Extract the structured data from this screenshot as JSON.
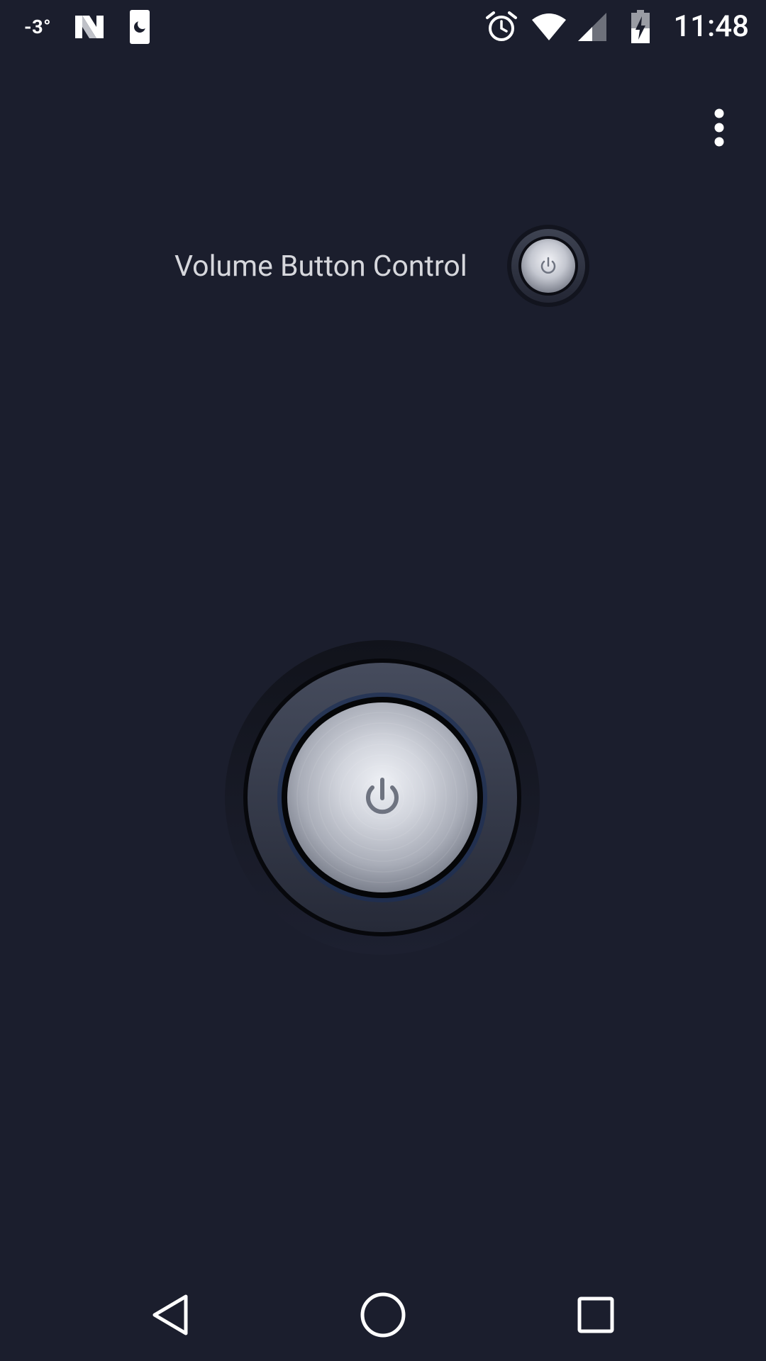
{
  "status_bar": {
    "temperature": "-3°",
    "time": "11:48",
    "left_icons": [
      "nova-launcher-icon",
      "night-mode-icon"
    ],
    "right_icons": [
      "alarm-icon",
      "wifi-icon",
      "cell-signal-icon",
      "battery-charging-icon"
    ]
  },
  "toolbar": {
    "menu_icon": "more-vert-icon"
  },
  "settings": {
    "volume_label": "Volume Button Control"
  },
  "main": {
    "power_icon": "power-icon"
  },
  "nav_bar": {
    "buttons": [
      "back-icon",
      "home-icon",
      "recents-icon"
    ]
  },
  "colors": {
    "background": "#1b1e2d",
    "text": "#d6d7dc",
    "metal_light": "#e6e8ee",
    "metal_dark": "#6f7481"
  }
}
